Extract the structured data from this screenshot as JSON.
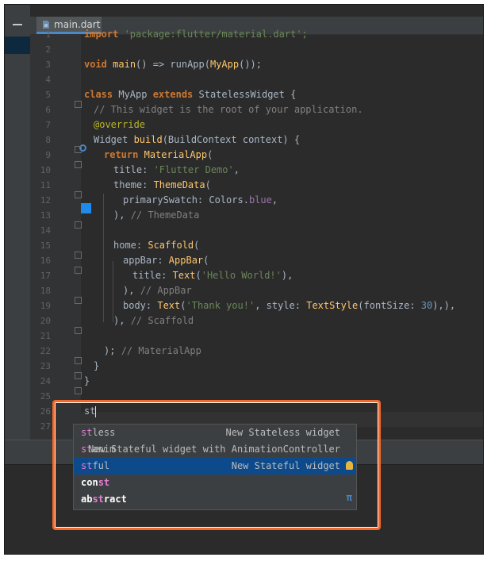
{
  "tab": {
    "label": "main.dart"
  },
  "line_numbers": [
    "1",
    "2",
    "3",
    "4",
    "5",
    "6",
    "7",
    "8",
    "9",
    "10",
    "11",
    "12",
    "13",
    "14",
    "15",
    "16",
    "17",
    "18",
    "19",
    "20",
    "21",
    "22",
    "23",
    "24",
    "25",
    "26",
    "27"
  ],
  "code": {
    "l1": {
      "kw": "import",
      "str": " 'package:flutter/material.dart';"
    },
    "l3": {
      "kw": "void",
      "fn": "main",
      "a": "() => runApp(",
      "cls": "MyApp",
      "b": "());"
    },
    "l5": {
      "kw1": "class",
      "a": " MyApp ",
      "kw2": "extends",
      "b": " StatelessWidget {"
    },
    "l6": "// This widget is the root of your application.",
    "l7": "@override",
    "l8": {
      "a": "Widget ",
      "fn": "build",
      "b": "(BuildContext context) {"
    },
    "l9": {
      "kw": "return",
      "fn": "MaterialApp",
      "b": "("
    },
    "l10": {
      "a": "title: ",
      "str": "'Flutter Demo'",
      "b": ","
    },
    "l11": {
      "a": "theme: ",
      "fn": "ThemeData",
      "b": "("
    },
    "l12": {
      "a": "primarySwatch: Colors.",
      "prop": "blue",
      "b": ","
    },
    "l13": {
      "a": "), ",
      "cm": "// ThemeData"
    },
    "l15": {
      "a": "home: ",
      "fn": "Scaffold",
      "b": "("
    },
    "l16": {
      "a": "appBar: ",
      "fn": "AppBar",
      "b": "("
    },
    "l17": {
      "a": "title: ",
      "fn": "Text",
      "b": "(",
      "str": "'Hello World!'",
      "c": "),"
    },
    "l18": {
      "a": "), ",
      "cm": "// AppBar"
    },
    "l19": {
      "a": "body: ",
      "fn": "Text",
      "b": "(",
      "str": "'Thank you!'",
      "c": ", style: ",
      "fn2": "TextStyle",
      "d": "(fontSize: ",
      "num": "30",
      "e": "),),"
    },
    "l20": {
      "a": "), ",
      "cm": "// Scaffold"
    },
    "l22": {
      "a": "); ",
      "cm": "// MaterialApp"
    },
    "l23": "}",
    "l24": "}",
    "l26": "st"
  },
  "completion": {
    "items": [
      {
        "match": "st",
        "rest": "less",
        "desc": "New Stateless widget"
      },
      {
        "match": "st",
        "rest": "anim",
        "desc": "New Stateful widget with AnimationController"
      },
      {
        "match": "st",
        "rest": "ful",
        "desc": "New Stateful widget"
      },
      {
        "pre": "con",
        "match": "st",
        "rest": "",
        "desc": ""
      },
      {
        "pre": "ab",
        "match": "st",
        "rest": "ract",
        "desc": ""
      }
    ],
    "selected_index": 2,
    "pi_symbol": "π"
  },
  "colors": {
    "highlight": "#f0692a",
    "selection": "#0d4a8b",
    "editor_bg": "#2b2b2b"
  }
}
